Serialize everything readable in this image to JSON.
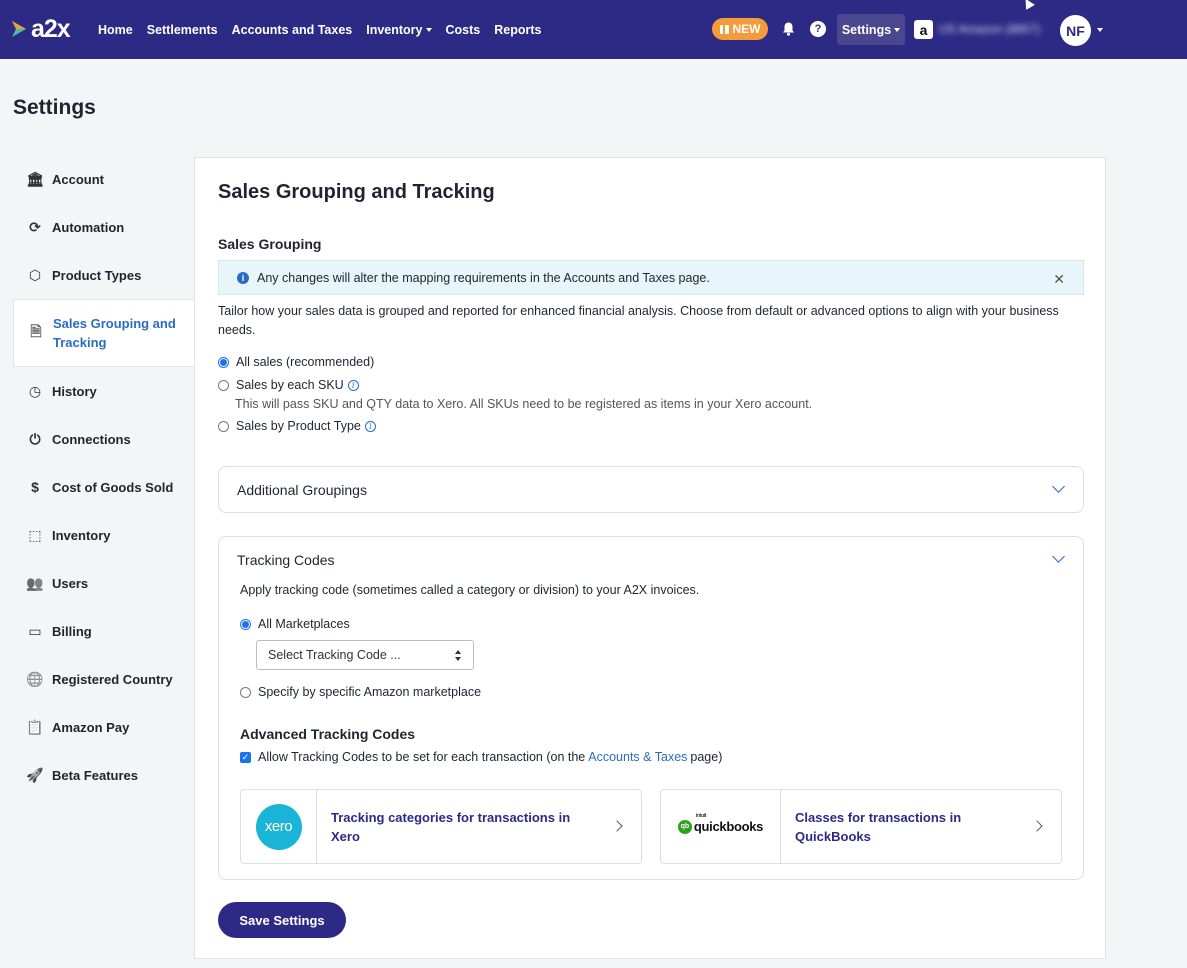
{
  "nav": {
    "logo": "a2x",
    "links": [
      {
        "label": "Home",
        "dropdown": false
      },
      {
        "label": "Settlements",
        "dropdown": false
      },
      {
        "label": "Accounts and Taxes",
        "dropdown": false
      },
      {
        "label": "Inventory",
        "dropdown": true
      },
      {
        "label": "Costs",
        "dropdown": false
      },
      {
        "label": "Reports",
        "dropdown": false
      }
    ],
    "new_badge": "NEW",
    "help": "?",
    "settings": "Settings",
    "amazon_mark": "a",
    "account_name": "US Amazon (8657)",
    "avatar": "NF"
  },
  "page": {
    "title": "Settings"
  },
  "sidebar": {
    "items": [
      {
        "label": "Account",
        "icon": "bank-icon"
      },
      {
        "label": "Automation",
        "icon": "sync-icon"
      },
      {
        "label": "Product Types",
        "icon": "cubes-icon"
      },
      {
        "label": "Sales Grouping and Tracking",
        "icon": "document-icon",
        "active": true
      },
      {
        "label": "History",
        "icon": "clock-icon"
      },
      {
        "label": "Connections",
        "icon": "plug-icon"
      },
      {
        "label": "Cost of Goods Sold",
        "icon": "dollar-icon"
      },
      {
        "label": "Inventory",
        "icon": "box-icon"
      },
      {
        "label": "Users",
        "icon": "users-icon"
      },
      {
        "label": "Billing",
        "icon": "card-icon"
      },
      {
        "label": "Registered Country",
        "icon": "globe-icon"
      },
      {
        "label": "Amazon Pay",
        "icon": "clipboard-icon"
      },
      {
        "label": "Beta Features",
        "icon": "rocket-icon"
      }
    ]
  },
  "main": {
    "title": "Sales Grouping and Tracking",
    "sales_grouping": {
      "label": "Sales Grouping",
      "banner": "Any changes will alter the mapping requirements in the Accounts and Taxes page.",
      "description": "Tailor how your sales data is grouped and reported for enhanced financial analysis. Choose from default or advanced options to align with your business needs.",
      "options": [
        {
          "label": "All sales (recommended)",
          "checked": true,
          "info": false
        },
        {
          "label": "Sales by each SKU",
          "checked": false,
          "info": true
        },
        {
          "label": "Sales by Product Type",
          "checked": false,
          "info": true
        }
      ],
      "sku_note": "This will pass SKU and QTY data to Xero. All SKUs need to be registered as items in your Xero account."
    },
    "additional_groupings": {
      "title": "Additional Groupings"
    },
    "tracking_codes": {
      "title": "Tracking Codes",
      "description": "Apply tracking code (sometimes called a category or division) to your A2X invoices.",
      "all_marketplaces": "All Marketplaces",
      "select_placeholder": "Select Tracking Code ...",
      "specify": "Specify by specific Amazon marketplace",
      "advanced_title": "Advanced Tracking Codes",
      "checkbox_before": "Allow Tracking Codes to be set for each transaction (on the",
      "checkbox_link": "Accounts & Taxes",
      "checkbox_after": "page)",
      "xero_card": {
        "logo": "xero",
        "text": "Tracking categories for transactions in Xero"
      },
      "qb_card": {
        "logo": "quickbooks",
        "intuit": "intuit",
        "mark": "qb",
        "text": "Classes for transactions in QuickBooks"
      }
    },
    "save_button": "Save Settings"
  },
  "colors": {
    "nav_bg": "#2d2a85",
    "accent": "#2a6cc4",
    "new_badge": "#f59b3a",
    "xero": "#1ab4d7",
    "quickbooks": "#2ca01c"
  }
}
